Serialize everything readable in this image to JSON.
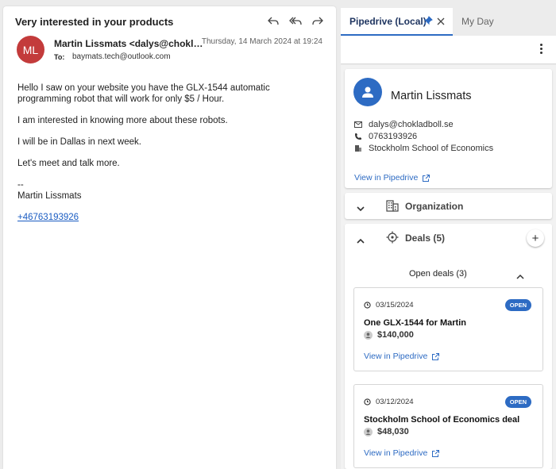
{
  "email": {
    "subject": "Very interested in your products",
    "avatar_initials": "ML",
    "sender": "Martin Lissmats <dalys@chokladboll.se>",
    "date": "Thursday, 14 March 2024 at 19:24",
    "to_label": "To:",
    "to": "baymats.tech@outlook.com",
    "body": [
      "Hello I saw on your website you have the GLX-1544 automatic programming robot that will work for only $5 / Hour.",
      "I am interested in knowing more about these robots.",
      "I will be in Dallas in next week.",
      "Let's meet and talk more."
    ],
    "signature_dash": "--",
    "signature_name": "Martin Lissmats",
    "phone_link": "+46763193926"
  },
  "tabs": {
    "active": "Pipedrive (Local)",
    "other": "My Day"
  },
  "person": {
    "name": "Martin Lissmats",
    "email": "dalys@chokladboll.se",
    "phone": "0763193926",
    "org": "Stockholm School of Economics",
    "link": "View in Pipedrive"
  },
  "organization": {
    "label": "Organization"
  },
  "deals": {
    "label": "Deals (5)",
    "open_label": "Open deals (3)",
    "items": [
      {
        "date": "03/15/2024",
        "status": "OPEN",
        "title": "One GLX-1544 for Martin",
        "value": "$140,000",
        "link": "View in Pipedrive"
      },
      {
        "date": "03/12/2024",
        "status": "OPEN",
        "title": "Stockholm School of Economics deal",
        "value": "$48,030",
        "link": "View in Pipedrive"
      }
    ]
  },
  "colors": {
    "accent": "#2d6bc3",
    "avatar": "#c33b3b"
  }
}
